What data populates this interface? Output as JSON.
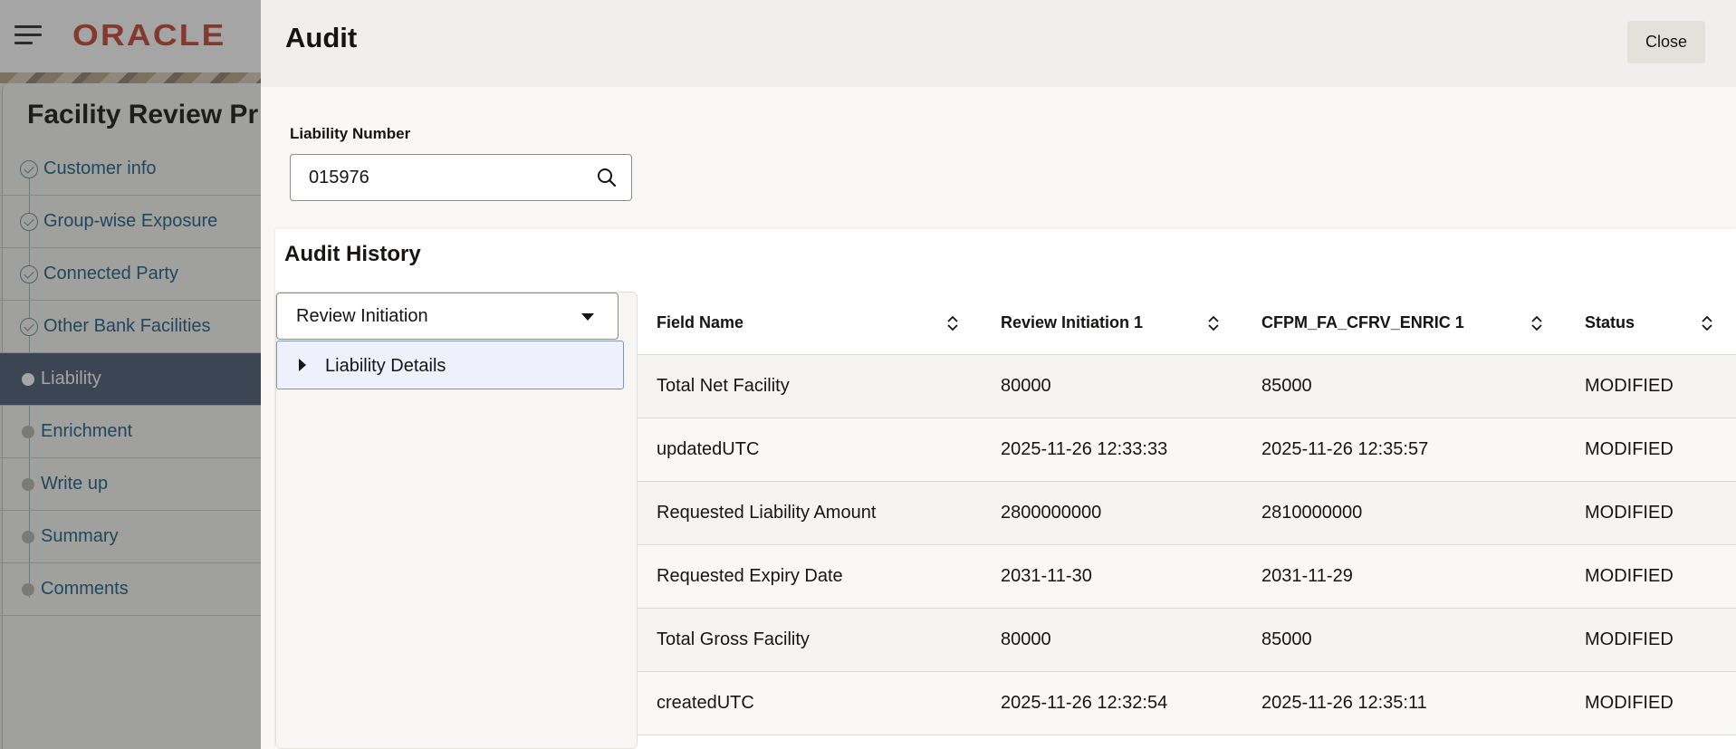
{
  "background": {
    "logo_text": "ORACLE",
    "page_title": "Facility Review Pr",
    "steps": [
      {
        "label": "Customer info",
        "state": "done"
      },
      {
        "label": "Group-wise Exposure",
        "state": "done"
      },
      {
        "label": "Connected Party",
        "state": "done"
      },
      {
        "label": "Other Bank Facilities",
        "state": "done"
      },
      {
        "label": "Liability",
        "state": "active"
      },
      {
        "label": "Enrichment",
        "state": "pending"
      },
      {
        "label": "Write up",
        "state": "pending"
      },
      {
        "label": "Summary",
        "state": "pending"
      },
      {
        "label": "Comments",
        "state": "pending"
      }
    ]
  },
  "drawer": {
    "title": "Audit",
    "close_label": "Close",
    "liability_number": {
      "label": "Liability Number",
      "value": "015976"
    },
    "history": {
      "title": "Audit History",
      "selected_stage": "Review Initiation",
      "tree_item": "Liability Details",
      "columns": [
        "Field Name",
        "Review Initiation 1",
        "CFPM_FA_CFRV_ENRIC 1",
        "Status"
      ],
      "rows": [
        [
          "Total Net Facility",
          "80000",
          "85000",
          "MODIFIED"
        ],
        [
          "updatedUTC",
          "2025-11-26 12:33:33",
          "2025-11-26 12:35:57",
          "MODIFIED"
        ],
        [
          "Requested Liability Amount",
          "2800000000",
          "2810000000",
          "MODIFIED"
        ],
        [
          "Requested Expiry Date",
          "2031-11-30",
          "2031-11-29",
          "MODIFIED"
        ],
        [
          "Total Gross Facility",
          "80000",
          "85000",
          "MODIFIED"
        ],
        [
          "createdUTC",
          "2025-11-26 12:32:54",
          "2025-11-26 12:35:11",
          "MODIFIED"
        ]
      ]
    }
  },
  "colors": {
    "brand_red": "#c74634",
    "active_step": "#4a5a73",
    "link_text": "#1b5e7e",
    "selected_tree_bg": "#eef0fb"
  }
}
